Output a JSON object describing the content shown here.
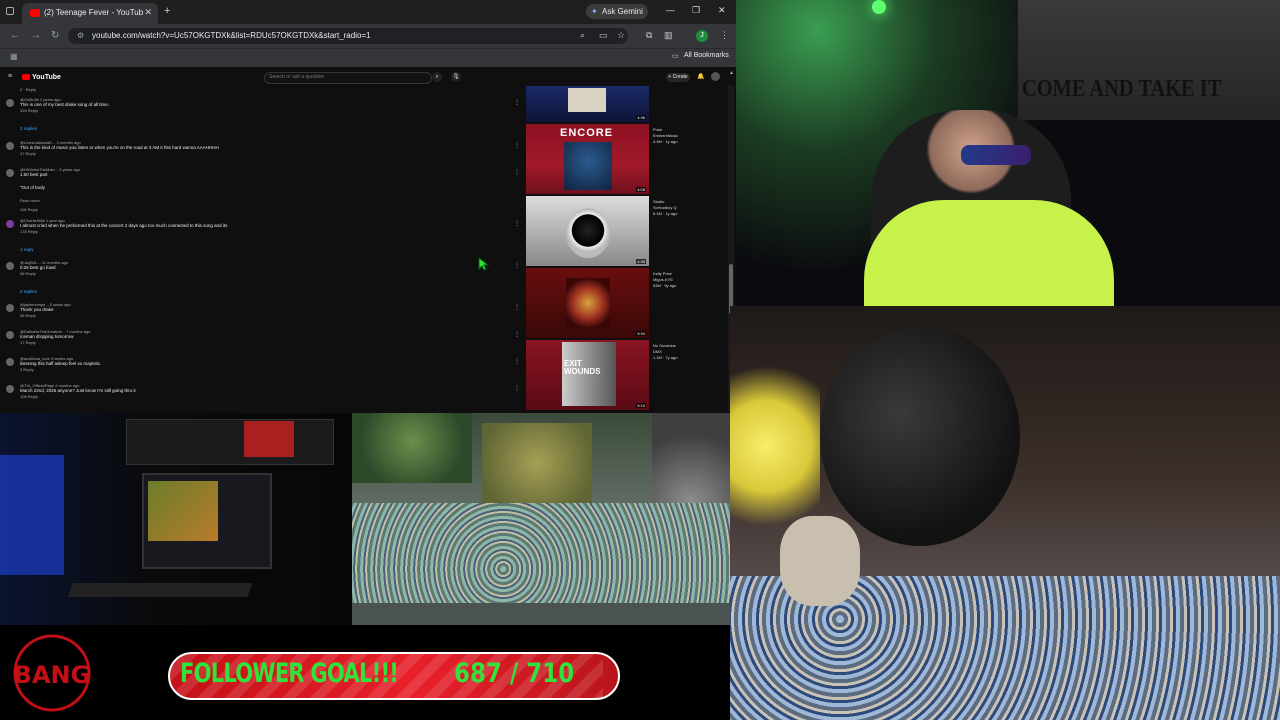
{
  "browser": {
    "tab_title": "(2) Teenage Fever - YouTub",
    "ask_gemini": "Ask Gemini",
    "url": "youtube.com/watch?v=Uc57OKGTDXk&list=RDUc57OKGTDXk&start_radio=1",
    "all_bookmarks": "All Bookmarks",
    "profile_initial": "J"
  },
  "youtube": {
    "logo": "YouTube",
    "search_placeholder": "Search or ask a question",
    "create_label": "+ Create",
    "comments": [
      {
        "header": "@Ow5u9k 2 years ago",
        "body": "This is one of my best drake song of all time..",
        "meta": "328  Reply"
      },
      {
        "replies": "2 replies"
      },
      {
        "header": "@LivesInAtlantaD... 3 months ago",
        "body": "This is the kind of music you listen to when you're on the road at 3 AM it hits hard wanna AAAHHHH",
        "meta": "47  Reply"
      },
      {
        "header": "@HitVideoTheMain... 3 years ago",
        "body": "1:50 best part",
        "body2": "\"Out of body",
        "more": "Read more",
        "meta": "116  Reply"
      },
      {
        "header": "@CharlieMills 1 year ago",
        "body": "I almost cried when he preformed this at the concert 2 days ago too much connected to this song and its",
        "meta": "178  Reply"
      },
      {
        "replies": "1 reply"
      },
      {
        "header": "@JayB4L... 11 months ago",
        "body": "0:25 best go fowd",
        "meta": "56  Reply"
      },
      {
        "replies": "2 replies"
      },
      {
        "header": "@jaylemcmpe... 2 years ago",
        "body": "Thank you drake",
        "meta": "36  Reply"
      },
      {
        "header": "@DaNaNaTheGreatest... 7 months ago",
        "body": "Iceman dropping tomorrow",
        "meta": "17  Reply"
      },
      {
        "header": "@anaflowa_look 3 weeks ago",
        "body": "listening this half asleep feel so majestic.",
        "meta": "3  Reply"
      },
      {
        "header": "@TIA_OfficialPage 4 months ago",
        "body": "March 22nd, 2026 anyone? Just know I'm still going thru it",
        "meta": "108  Reply"
      }
    ],
    "playlist": [
      {
        "title": "",
        "channel": "",
        "duration": "4:36"
      },
      {
        "title": "Puke",
        "channel": "EminemMusic",
        "views": "4.4M · 1y ago",
        "duration": "4:08",
        "art_text": "ENCORE"
      },
      {
        "title": "Studio",
        "channel": "ScHoolboy Q",
        "views": "8.1M · 1y ago",
        "duration": "4:35",
        "art_text": ""
      },
      {
        "title": "Kelly Price",
        "channel": "Migos-KYE",
        "views": "53M · 9y ago",
        "duration": "5:34",
        "art_text": ""
      },
      {
        "title": "No Sunshine",
        "channel": "DMX",
        "views": "1.1M · 7y ago",
        "duration": "5:10",
        "art_text": "EXIT WOUNDS"
      }
    ]
  },
  "overlay": {
    "goal_label": "FOLLOWER GOAL!!!",
    "goal_count": "687 / 710",
    "goal_progress": 0.967,
    "logo_text": "BANG",
    "accent_green": "#2fe33a",
    "accent_red": "#e8202a"
  },
  "webcam": {
    "flag_text": "COME AND TAKE IT"
  }
}
